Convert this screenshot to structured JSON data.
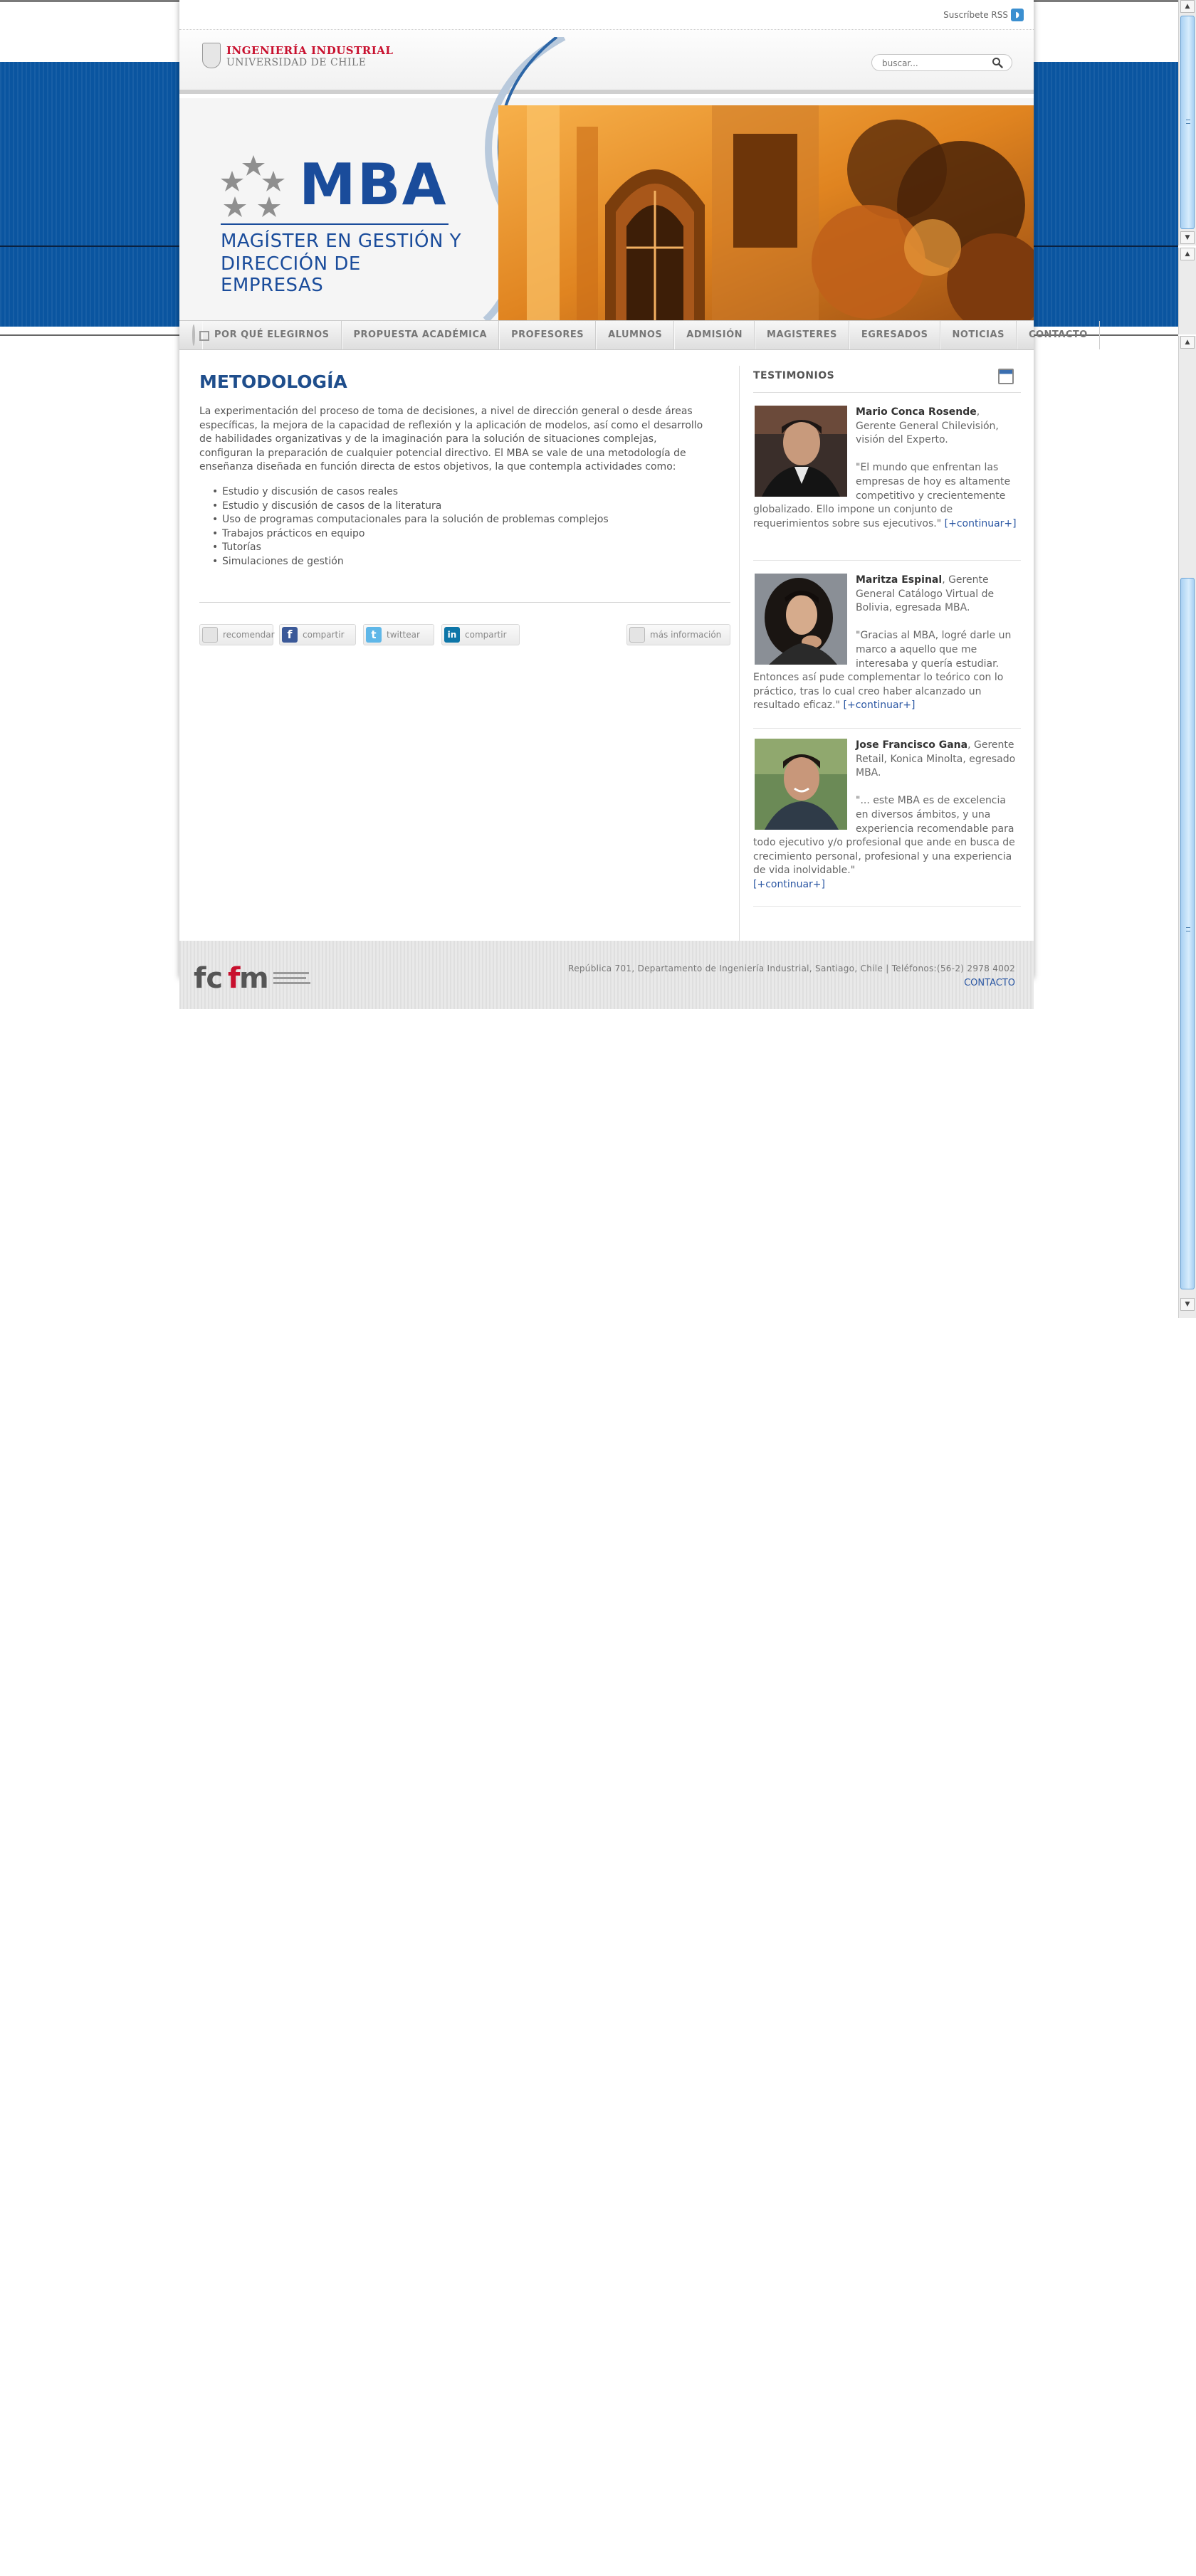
{
  "utility": {
    "rss_label": "Suscríbete RSS"
  },
  "header": {
    "logo_line1": "INGENIERÍA INDUSTRIAL",
    "logo_line2": "UNIVERSIDAD DE CHILE",
    "search_placeholder": "buscar..."
  },
  "banner": {
    "mba_title": "MBA",
    "mba_sub1": "MAGÍSTER EN GESTIÓN Y",
    "mba_sub2": "DIRECCIÓN DE EMPRESAS"
  },
  "nav": {
    "items": [
      "POR QUÉ ELEGIRNOS",
      "PROPUESTA ACADÉMICA",
      "PROFESORES",
      "ALUMNOS",
      "ADMISIÓN",
      "MAGISTERES",
      "EGRESADOS",
      "NOTICIAS",
      "CONTACTO"
    ]
  },
  "main": {
    "title": "METODOLOGÍA",
    "intro": "La experimentación del proceso de toma de decisiones, a nivel de dirección general o desde áreas específicas, la mejora de la capacidad de reflexión y la aplicación de modelos, así como el desarrollo de habilidades organizativas y de la imaginación para la solución de situaciones complejas, configuran la preparación de cualquier potencial directivo. El MBA se vale de una metodología de enseñanza diseñada en función directa de estos objetivos, la que contempla actividades como:",
    "activities": [
      "Estudio y discusión de casos reales",
      "Estudio y discusión de casos de la literatura",
      "Uso de programas computacionales para la solución de problemas complejos",
      "Trabajos prácticos en equipo",
      "Tutorías",
      "Simulaciones de gestión"
    ],
    "share": {
      "recommend": "recomendar",
      "facebook": "compartir",
      "twitter": "twittear",
      "linkedin": "compartir",
      "more_info": "más información"
    }
  },
  "sidebar": {
    "title": "TESTIMONIOS",
    "more_label": "[+continuar+]",
    "testimonials": [
      {
        "name": "Mario Conca Rosende",
        "role": ", Gerente General Chilevisión, visión del Experto.",
        "quote": "\"El mundo que enfrentan las empresas de hoy es altamente competitivo y crecientemente globalizado. Ello impone un conjunto de requerimientos sobre sus ejecutivos.\""
      },
      {
        "name": "Maritza Espinal",
        "role": ", Gerente General Catálogo Virtual de Bolivia, egresada MBA.",
        "quote": "\"Gracias al MBA, logré darle un marco a aquello que me interesaba y quería estudiar. Entonces así pude complementar lo teórico con lo práctico, tras lo cual creo haber alcanzado un resultado eficaz.\""
      },
      {
        "name": "Jose Francisco Gana",
        "role": ", Gerente Retail, Konica Minolta, egresado MBA.",
        "quote": "\"... este MBA es de excelencia en diversos ámbitos, y una experiencia recomendable para todo ejecutivo y/o profesional que ande en busca de crecimiento personal, profesional y una experiencia de vida inolvidable.\""
      }
    ]
  },
  "footer": {
    "address": "República 701, Departamento de Ingeniería Industrial, Santiago, Chile | Teléfonos:(56-2) 2978 4002",
    "contact": "CONTACTO"
  },
  "colors": {
    "brand_blue": "#1a4c9b",
    "band_blue": "#0a55a0",
    "link_blue": "#2b57a3",
    "logo_red": "#c8102e"
  }
}
